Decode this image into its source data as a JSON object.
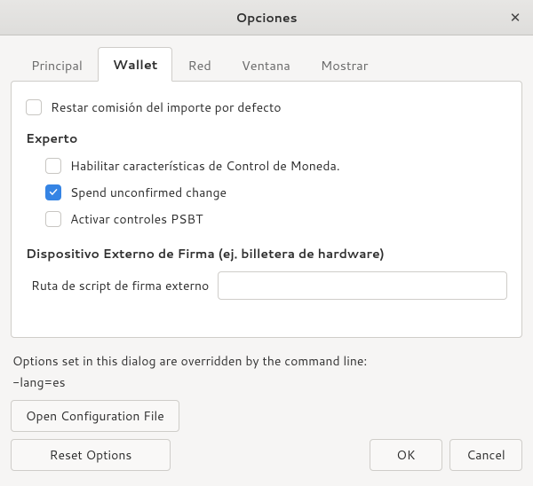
{
  "window": {
    "title": "Opciones"
  },
  "tabs": {
    "principal": "Principal",
    "wallet": "Wallet",
    "red": "Red",
    "ventana": "Ventana",
    "mostrar": "Mostrar"
  },
  "wallet_panel": {
    "subtract_fee": {
      "label": "Restar comisión del importe por defecto",
      "checked": false
    },
    "expert_heading": "Experto",
    "coin_control": {
      "label": "Habilitar características de Control de Moneda.",
      "checked": false
    },
    "spend_unconfirmed": {
      "label": "Spend unconfirmed change",
      "checked": true
    },
    "psbt_controls": {
      "label": "Activar controles PSBT",
      "checked": false
    },
    "external_signer_heading": "Dispositivo Externo de Firma (ej. billetera de hardware)",
    "script_path": {
      "label": "Ruta de script de firma externo",
      "value": ""
    }
  },
  "footer": {
    "override_note": "Options set in this dialog are overridden by the command line:",
    "override_value": "-lang=es",
    "open_config": "Open Configuration File",
    "reset": "Reset Options",
    "ok": "OK",
    "cancel": "Cancel"
  }
}
